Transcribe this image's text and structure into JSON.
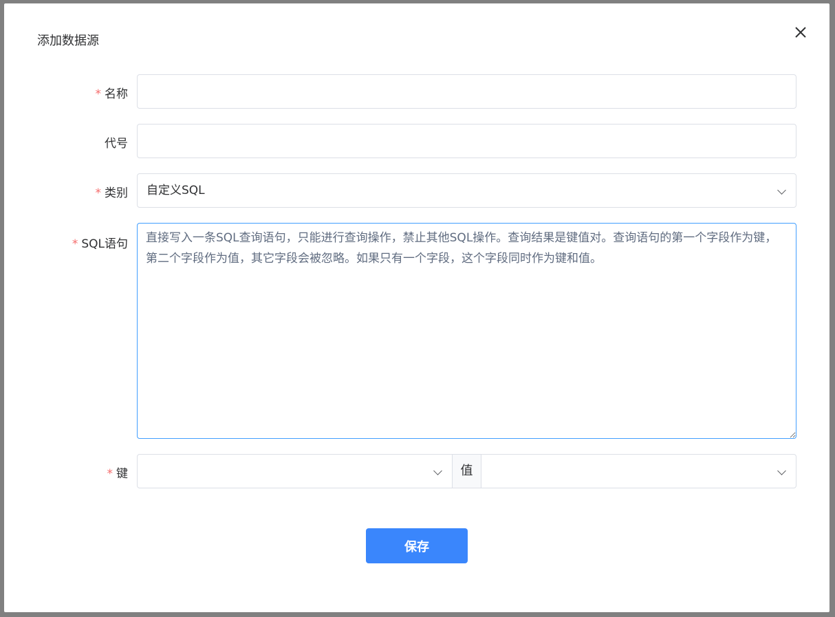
{
  "dialog": {
    "title": "添加数据源"
  },
  "form": {
    "name": {
      "label": "名称",
      "required_mark": "*",
      "value": ""
    },
    "code": {
      "label": "代号",
      "value": ""
    },
    "category": {
      "label": "类别",
      "required_mark": "*",
      "value": "自定义SQL"
    },
    "sql": {
      "label": "SQL语句",
      "required_mark": "*",
      "placeholder": "直接写入一条SQL查询语句，只能进行查询操作，禁止其他SQL操作。查询结果是键值对。查询语句的第一个字段作为键，第二个字段作为值，其它字段会被忽略。如果只有一个字段，这个字段同时作为键和值。"
    },
    "key": {
      "label": "键",
      "required_mark": "*",
      "value": ""
    },
    "value": {
      "label": "值",
      "value": ""
    }
  },
  "actions": {
    "save_label": "保存"
  }
}
